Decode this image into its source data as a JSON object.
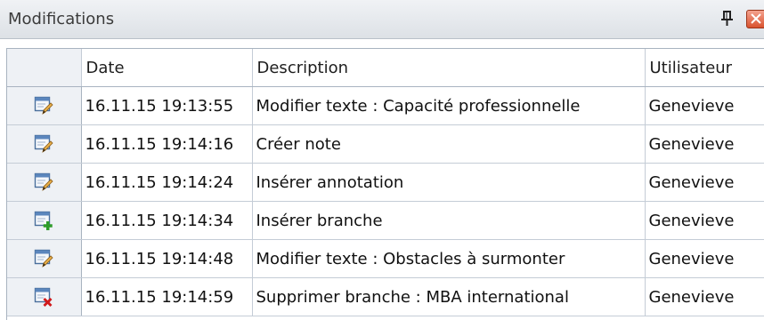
{
  "panel": {
    "title": "Modifications",
    "pin_icon": "pin-icon",
    "close_icon": "close-icon"
  },
  "columns": {
    "date": "Date",
    "description": "Description",
    "user": "Utilisateur"
  },
  "rows": [
    {
      "icon": "edit-icon",
      "date": "16.11.15 19:13:55",
      "description": "Modifier texte : Capacité professionnelle",
      "user": "Genevieve"
    },
    {
      "icon": "edit-icon",
      "date": "16.11.15 19:14:16",
      "description": "Créer note",
      "user": "Genevieve"
    },
    {
      "icon": "edit-icon",
      "date": "16.11.15 19:14:24",
      "description": "Insérer annotation",
      "user": "Genevieve"
    },
    {
      "icon": "add-icon",
      "date": "16.11.15 19:14:34",
      "description": "Insérer branche",
      "user": "Genevieve"
    },
    {
      "icon": "edit-icon",
      "date": "16.11.15 19:14:48",
      "description": "Modifier texte : Obstacles à surmonter",
      "user": "Genevieve"
    },
    {
      "icon": "delete-icon",
      "date": "16.11.15 19:14:59",
      "description": "Supprimer  branche : MBA international",
      "user": "Genevieve"
    }
  ],
  "colors": {
    "title_bar": "#dde1e6",
    "icon_column": "#eef1f5",
    "close_button": "#d9532f",
    "add_badge": "#2e9c2a",
    "delete_badge": "#d0181a"
  }
}
